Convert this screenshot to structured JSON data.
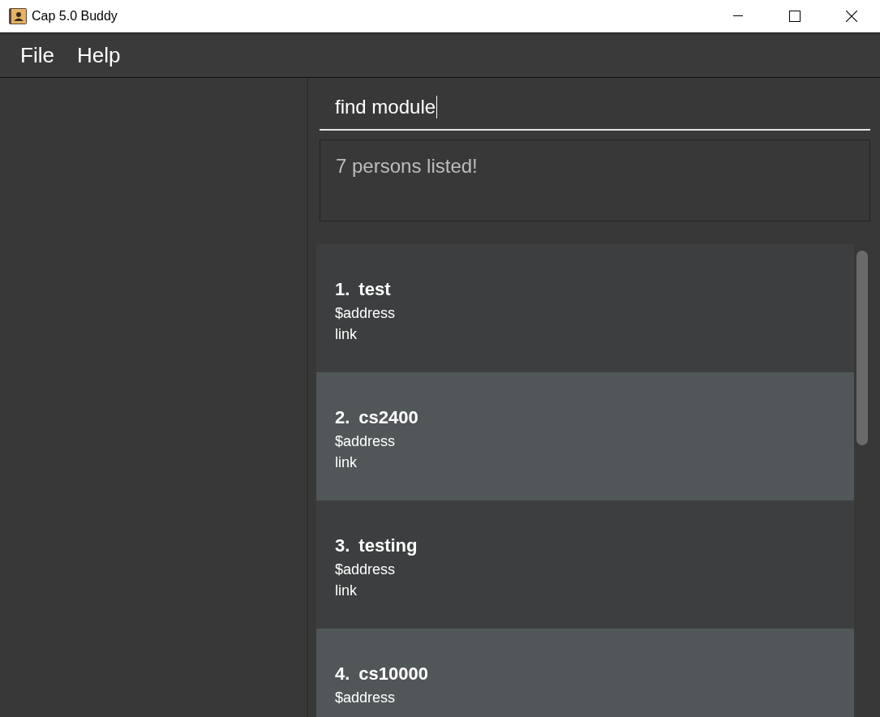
{
  "window": {
    "title": "Cap 5.0 Buddy"
  },
  "menu": [
    "File",
    "Help"
  ],
  "command": {
    "value": "find module"
  },
  "result": "7 persons listed!",
  "list": [
    {
      "index": "1.",
      "name": "test",
      "lines": [
        "$address",
        "link"
      ]
    },
    {
      "index": "2.",
      "name": "cs2400",
      "lines": [
        "$address",
        "link"
      ]
    },
    {
      "index": "3.",
      "name": "testing",
      "lines": [
        "$address",
        "link"
      ]
    },
    {
      "index": "4.",
      "name": "cs10000",
      "lines": [
        "$address"
      ]
    }
  ]
}
